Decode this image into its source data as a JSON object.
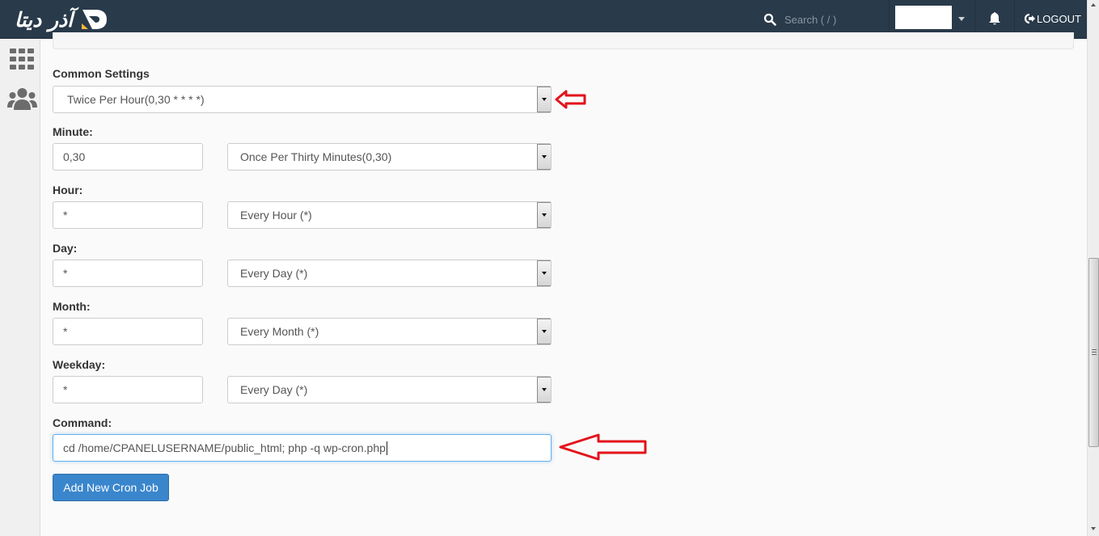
{
  "header": {
    "brand": "آذر دیتا",
    "brand_colors": {
      "dark": "#293a4a",
      "accent": "#f6b93b"
    },
    "search": {
      "placeholder": "Search ( / )",
      "icon": "search-icon"
    },
    "user_menu": {
      "icon": "caret-down-icon"
    },
    "notifications": {
      "icon": "bell-icon"
    },
    "logout": {
      "label": "LOGOUT",
      "icon": "sign-out-icon"
    }
  },
  "sidebar": {
    "items": [
      {
        "name": "apps",
        "icon": "grid-icon"
      },
      {
        "name": "users",
        "icon": "users-icon"
      }
    ]
  },
  "form": {
    "common_settings": {
      "label": "Common Settings",
      "selected": "Twice Per Hour(0,30 * * * *)"
    },
    "minute": {
      "label": "Minute:",
      "value": "0,30",
      "selected": "Once Per Thirty Minutes(0,30)"
    },
    "hour": {
      "label": "Hour:",
      "value": "*",
      "selected": "Every Hour (*)"
    },
    "day": {
      "label": "Day:",
      "value": "*",
      "selected": "Every Day (*)"
    },
    "month": {
      "label": "Month:",
      "value": "*",
      "selected": "Every Month (*)"
    },
    "weekday": {
      "label": "Weekday:",
      "value": "*",
      "selected": "Every Day (*)"
    },
    "command": {
      "label": "Command:",
      "value": "cd /home/CPANELUSERNAME/public_html; php -q wp-cron.php"
    },
    "submit_label": "Add New Cron Job"
  },
  "annotations": {
    "arrow_color": "#e3131b"
  },
  "colors": {
    "primary_button": "#3a86cc",
    "focus_border": "#66afe9"
  }
}
